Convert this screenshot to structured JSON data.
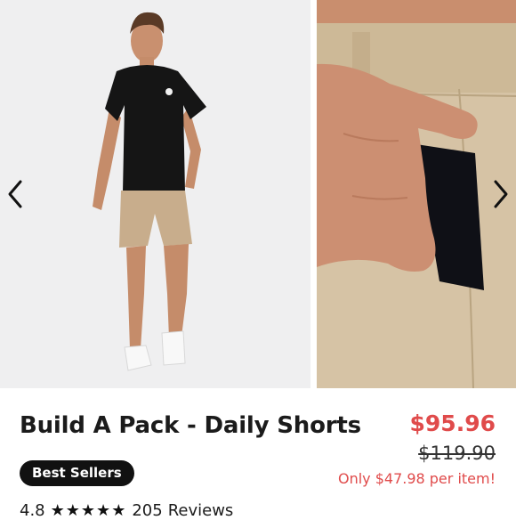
{
  "gallery": {
    "prev_icon": "chevron-left-icon",
    "next_icon": "chevron-right-icon",
    "image1_subject": "man-in-shorts",
    "image2_subject": "pocket-closeup"
  },
  "product": {
    "title": "Build A Pack - Daily Shorts",
    "badge": "Best Sellers",
    "price": "$95.96",
    "old_price": "$119.90",
    "per_item": "Only $47.98 per item!",
    "rating": "4.8",
    "stars": "★★★★★",
    "reviews_count": "205",
    "reviews_label": "Reviews"
  },
  "colors": {
    "sale_red": "#e04b4b",
    "badge_bg": "#111111",
    "text": "#1b1b1b"
  }
}
